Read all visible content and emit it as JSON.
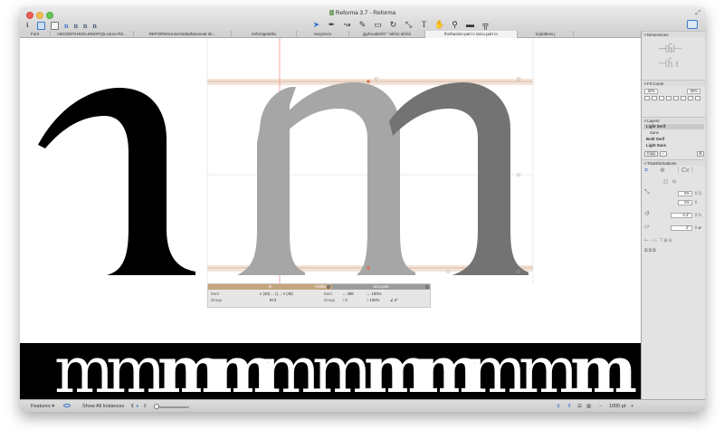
{
  "window": {
    "title": "Reforma 3.7 - Reforma"
  },
  "toolbar": {
    "left_glyphs": [
      "n",
      "n",
      "n",
      "n"
    ],
    "tools": [
      "arrow-tool",
      "pen-tool",
      "curve-tool",
      "knife-tool",
      "rectangle-tool",
      "rotate-tool",
      "scale-tool",
      "text-tool",
      "hand-tool",
      "zoom-tool",
      "measure-tool",
      "anchor-tool"
    ]
  },
  "tabs": [
    "Font",
    "ABCDEFGHIJKLMNOPQ/Lcaron RS...",
    "REFORMAUniversidadNacional de...",
    "/erfontgantillo",
    "vwxyzezo",
    "jgyhsvaltehhˆˆ àèìòù áéíóú",
    "lhn/baston.part n /arco.part m",
    "iii.jdotless.j"
  ],
  "active_tab": 6,
  "info_panel": {
    "left_title": "m",
    "left_value": "Visible",
    "right_title": "arco.part",
    "kern_label": "Kern",
    "kern_value": "n (40)  ←| |→  n (48)",
    "group_label": "Group",
    "group_value": "873",
    "right_kern_label": "Kern",
    "right_kern_value": "↔ 298",
    "right_group_label": "Group",
    "right_group_value": "↕ 0",
    "scale_x": "↔ 100%",
    "scale_y": "↕ 100%",
    "angle": "∠ 0°"
  },
  "preview": {
    "glyph": "m",
    "weights": [
      "normal",
      "normal",
      "bold",
      "bold",
      "normal",
      "normal",
      "bold",
      "bold",
      "normal",
      "normal",
      "bold",
      "bold"
    ]
  },
  "sidebar": {
    "dimensions_label": "Dimensions",
    "fit_curve_label": "Fit Curve",
    "fit_min": "60%",
    "fit_max": "80%",
    "layers_label": "Layers",
    "layers": [
      "Light Serif",
      "Sans",
      "Bold Serif",
      "Light Sans"
    ],
    "selected_layer": 0,
    "copy_button": "Copy",
    "transformations_label": "Transformations",
    "scale_value": "0%",
    "scale_step": "2%",
    "rotate_value": "0,4°",
    "slant_value": "2°"
  },
  "statusbar": {
    "features_label": "Features",
    "show_instances_label": "Show All Instances",
    "zoom_value": "1000 pt",
    "zoom_minus": "−",
    "zoom_plus": "+"
  },
  "colors": {
    "accent": "#2f6fd0",
    "guide": "#e8c9b0",
    "guide_line": "#d98b6c",
    "info_header": "#c5a57d"
  }
}
